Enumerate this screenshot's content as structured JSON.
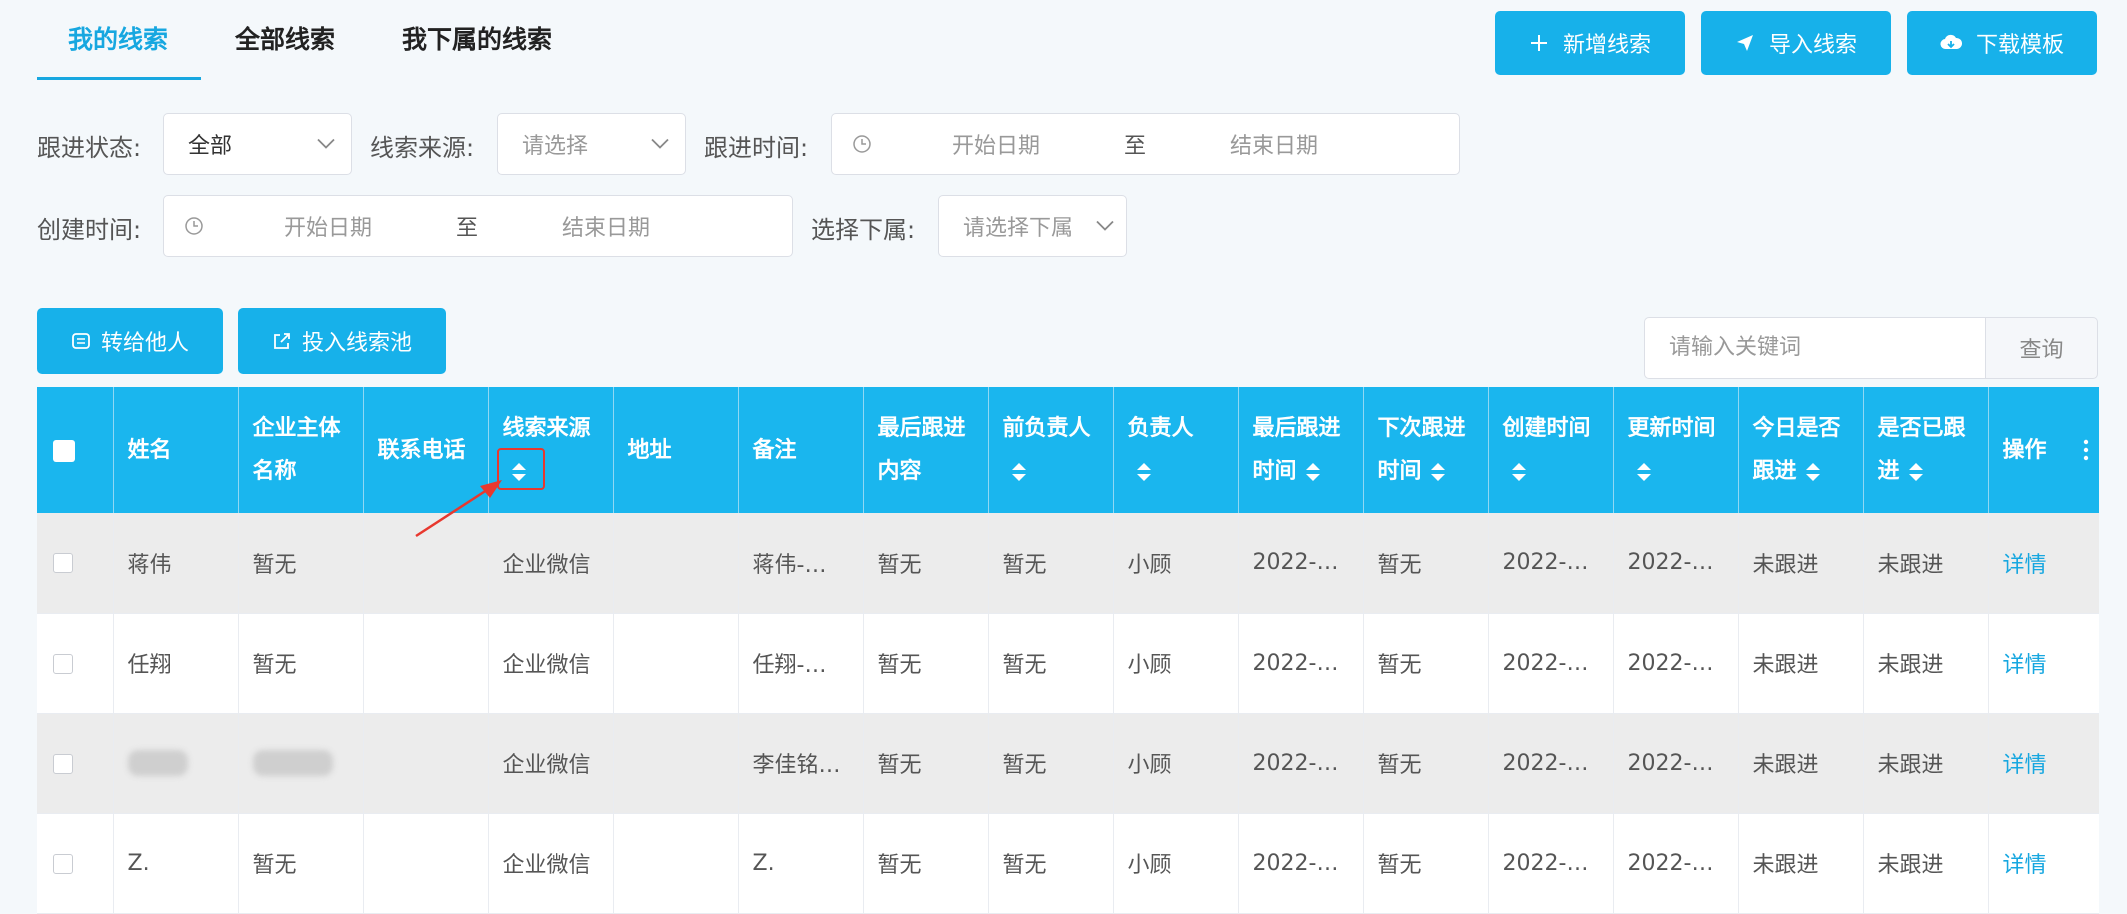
{
  "tabs": [
    "我的线索",
    "全部线索",
    "我下属的线索"
  ],
  "actions": {
    "add": "新增线索",
    "import": "导入线索",
    "download": "下载模板"
  },
  "filters": {
    "status_label": "跟进状态:",
    "status_value": "全部",
    "source_label": "线索来源:",
    "source_placeholder": "请选择",
    "follow_time_label": "跟进时间:",
    "create_time_label": "创建时间:",
    "start_placeholder": "开始日期",
    "to": "至",
    "end_placeholder": "结束日期",
    "sub_label": "选择下属:",
    "sub_placeholder": "请选择下属"
  },
  "toolbar": {
    "transfer": "转给他人",
    "pool": "投入线索池"
  },
  "search": {
    "placeholder": "请输入关键词",
    "button": "查询"
  },
  "columns": [
    {
      "l1": "姓名",
      "l2": "",
      "sort": false
    },
    {
      "l1": "企业主体",
      "l2": "名称",
      "sort": false
    },
    {
      "l1": "联系电话",
      "l2": "",
      "sort": false
    },
    {
      "l1": "线索来源",
      "l2": "",
      "sort": true
    },
    {
      "l1": "地址",
      "l2": "",
      "sort": false
    },
    {
      "l1": "备注",
      "l2": "",
      "sort": false
    },
    {
      "l1": "最后跟进",
      "l2": "内容",
      "sort": false
    },
    {
      "l1": "前负责人",
      "l2": "",
      "sort": true
    },
    {
      "l1": "负责人",
      "l2": "",
      "sort": true
    },
    {
      "l1": "最后跟进",
      "l2": "时间",
      "sort": true
    },
    {
      "l1": "下次跟进",
      "l2": "时间",
      "sort": true
    },
    {
      "l1": "创建时间",
      "l2": "",
      "sort": true
    },
    {
      "l1": "更新时间",
      "l2": "",
      "sort": true
    },
    {
      "l1": "今日是否",
      "l2": "跟进",
      "sort": true
    },
    {
      "l1": "是否已跟",
      "l2": "进",
      "sort": true
    },
    {
      "l1": "操作",
      "l2": "",
      "sort": false
    }
  ],
  "rows": [
    {
      "name": "蒋伟",
      "company": "暂无",
      "phone": "",
      "source": "企业微信",
      "address": "",
      "remark": "蒋伟-…",
      "last_content": "暂无",
      "prev_owner": "暂无",
      "owner": "小顾",
      "last_time": "2022-0…",
      "next_time": "暂无",
      "created": "2022-0…",
      "updated": "2022-0…",
      "today": "未跟进",
      "followed": "未跟进",
      "op": "详情"
    },
    {
      "name": "任翔",
      "company": "暂无",
      "phone": "",
      "source": "企业微信",
      "address": "",
      "remark": "任翔-…",
      "last_content": "暂无",
      "prev_owner": "暂无",
      "owner": "小顾",
      "last_time": "2022-0…",
      "next_time": "暂无",
      "created": "2022-0…",
      "updated": "2022-0…",
      "today": "未跟进",
      "followed": "未跟进",
      "op": "详情"
    },
    {
      "name": "",
      "company": "",
      "phone": "",
      "source": "企业微信",
      "address": "",
      "remark": "李佳铭…",
      "last_content": "暂无",
      "prev_owner": "暂无",
      "owner": "小顾",
      "last_time": "2022-0…",
      "next_time": "暂无",
      "created": "2022-0…",
      "updated": "2022-0…",
      "today": "未跟进",
      "followed": "未跟进",
      "op": "详情"
    },
    {
      "name": "Z.",
      "company": "暂无",
      "phone": "",
      "source": "企业微信",
      "address": "",
      "remark": "Z.",
      "last_content": "暂无",
      "prev_owner": "暂无",
      "owner": "小顾",
      "last_time": "2022-0…",
      "next_time": "暂无",
      "created": "2022-0…",
      "updated": "2022-0…",
      "today": "未跟进",
      "followed": "未跟进",
      "op": "详情"
    }
  ],
  "colors": {
    "accent": "#17b1ea",
    "header_bg": "#1ab6ee",
    "link": "#17a7e0",
    "annotation": "#e8382e"
  },
  "icons": [
    "plus-icon",
    "paper-plane-icon",
    "cloud-download-icon",
    "transfer-icon",
    "export-icon",
    "chevron-down-icon",
    "clock-icon",
    "sort-icon",
    "kebab-menu-icon"
  ]
}
